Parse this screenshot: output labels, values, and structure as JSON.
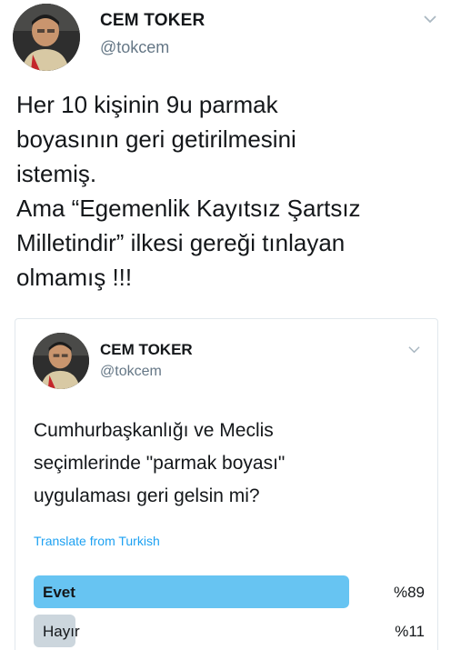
{
  "outer_tweet": {
    "author_name": "CEM TOKER",
    "author_handle": "@tokcem",
    "text": "Her 10 kişinin 9u parmak\nboyasının geri getirilmesini\nistemiş.\nAma “Egemenlik Kayıtsız Şartsız\nMilletindir” ilkesi gereği tınlayan\nolmamış !!!",
    "menu_icon": "chevron-down-icon"
  },
  "quoted_tweet": {
    "author_name": "CEM TOKER",
    "author_handle": "@tokcem",
    "text": "Cumhurbaşkanlığı ve Meclis\nseçimlerinde \"parmak boyası\"\nuygulaması geri gelsin mi?",
    "translate_label": "Translate from Turkish",
    "menu_icon": "chevron-down-icon",
    "poll": {
      "options": [
        {
          "label": "Evet",
          "percent_label": "%89",
          "fraction": 0.89,
          "leading": true
        },
        {
          "label": "Hayır",
          "percent_label": "%11",
          "fraction": 0.11,
          "leading": false
        }
      ]
    }
  },
  "colors": {
    "text": "#14171a",
    "secondary_text": "#657786",
    "link": "#1da1f2",
    "poll_leading_bar": "#67c4f2",
    "poll_other_bar": "#ccd6dd",
    "card_border": "#e1e8ed"
  }
}
